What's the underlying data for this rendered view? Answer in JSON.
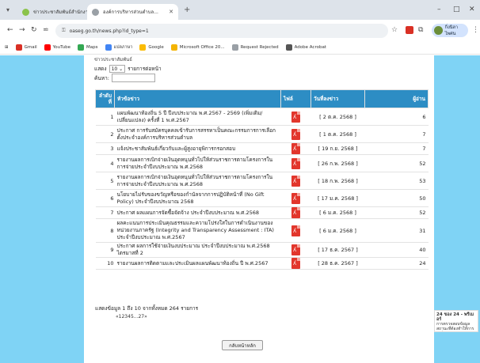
{
  "browser": {
    "tabs": [
      {
        "title": "ข่าวประชาสัมพันธ์สำนักงาน...",
        "active": false
      },
      {
        "title": "องค์การบริหารส่วนตำบล...",
        "active": true
      }
    ],
    "url": "oaseg.go.th/news.php?id_type=1",
    "profile_label": "กิ่งนิลาไพศน"
  },
  "bookmarks": [
    {
      "label": "Gmail",
      "color": "#d93025"
    },
    {
      "label": "YouTube",
      "color": "#ff0000"
    },
    {
      "label": "Maps",
      "color": "#34a853"
    },
    {
      "label": "แปลภาษา",
      "color": "#4285f4"
    },
    {
      "label": "Google",
      "color": "#fbbc04"
    },
    {
      "label": "Microsoft Office 20...",
      "color": "#f4b400"
    },
    {
      "label": "Request Rejected",
      "color": "#9aa0a6"
    },
    {
      "label": "Adobe Acrobat",
      "color": "#555555"
    }
  ],
  "controls": {
    "cut_text": "ข่าวประชาสัมพันธ์",
    "show_label": "แสดง",
    "per_page": "10",
    "per_page_suffix": "รายการต่อหน้า",
    "search_label": "ค้นหา:"
  },
  "table": {
    "headers": {
      "no": "ลำดับที่",
      "title": "หัวข้อข่าว",
      "file": "ไฟล์",
      "date": "วันที่ลงข่าว",
      "count": "ผู้อ่าน"
    },
    "rows": [
      {
        "no": "1",
        "title": "แผนพัฒนาท้องถิ่น 5 ปี ปีงบประมาณ พ.ศ.2567 - 2569 (เพิ่มเติม/เปลี่ยนแปลง) ครั้งที่ 1 พ.ศ.2567",
        "date": "[ 2 ต.ค. 2568 ]",
        "count": "6"
      },
      {
        "no": "2",
        "title": "ประกาศ การรับสมัครบุคคลเข้ารับการสรรหาเป็นคณะกรรมการการเลือกตั้งประจำองค์การบริหารส่วนตำบล",
        "date": "[ 1 ต.ค. 2568 ]",
        "count": "7"
      },
      {
        "no": "3",
        "title": "แจ้งประชาสัมพันธ์เกี่ยวกับและผู้สูงอายุพิการกรอกสอบ",
        "date": "[ 19 ก.ย. 2568 ]",
        "count": "7"
      },
      {
        "no": "4",
        "title": "รายงานผลการเบิกจ่ายเงินอุดหนุนทั่วไปให้ส่วนราชการตามโครงการในการจ่ายประจำปีงบประมาณ พ.ศ.2568",
        "date": "[ 26 ก.พ. 2568 ]",
        "count": "52"
      },
      {
        "no": "5",
        "title": "รายงานผลการเบิกจ่ายเงินอุดหนุนทั่วไปให้ส่วนราชการตามโครงการในการจ่ายประจำปีงบประมาณ พ.ศ.2568",
        "date": "[ 18 ก.พ. 2568 ]",
        "count": "53"
      },
      {
        "no": "6",
        "title": "นโยบายไม่รับของขวัญหรือของกำนัลจากการปฏิบัติหน้าที่ (No Gift Policy) ประจำปีงบประมาณ 2568",
        "date": "[ 17 ม.ค. 2568 ]",
        "count": "50"
      },
      {
        "no": "7",
        "title": "ประกาศ ผลแผนการจัดซื้อจัดจ้าง ประจำปีงบประมาณ พ.ศ.2568",
        "date": "[ 6 ม.ค. 2568 ]",
        "count": "52"
      },
      {
        "no": "8",
        "title": "ผลคะแนนการประเมินคุณธรรมและความโปร่งใสในการดำเนินงานของหน่วยงานภาครัฐ (Integrity and Transparency Assessment : ITA) ประจำปีงบประมาณ พ.ศ.2567",
        "date": "[ 6 ม.ค. 2568 ]",
        "count": "31"
      },
      {
        "no": "9",
        "title": "ประกาศ ผลการใช้จ่ายเงินงบประมาณ ประจำปีงบประมาณ พ.ศ.2568 ไตรมาสที่ 2",
        "date": "[ 17 ธ.ค. 2567 ]",
        "count": "40"
      },
      {
        "no": "10",
        "title": "รายงานผลการติดตามและประเมินผลแผนพัฒนาท้องถิ่น ปี พ.ศ.2567",
        "date": "[ 28 ธ.ค. 2567 ]",
        "count": "24"
      }
    ]
  },
  "summary": "แสดงข้อมูล 1 ถึง 10 จากทั้งหมด 264 รายการ",
  "pager": "«12345...27»",
  "home_button": "กลับหน้าหลัก",
  "notification": {
    "title": "24 ของ 24 - พรีเมอร์",
    "body": "การตรวจสอบข้อมูล สถานะที่ต้องทำให้การส่งสิ่ง"
  }
}
